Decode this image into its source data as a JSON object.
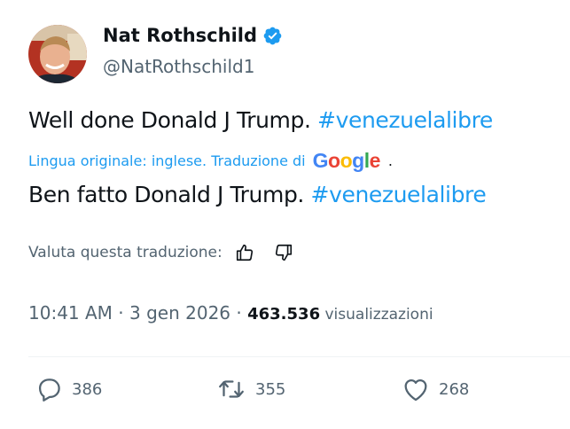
{
  "author": {
    "name": "Nat Rothschild",
    "handle": "@NatRothschild1",
    "verified_color": "#1d9bf0"
  },
  "tweet": {
    "text_plain": "Well done Donald J Trump. ",
    "hashtag": "#venezuelalibre",
    "translation_note": "Lingua originale: inglese. Traduzione di",
    "translator_logo": "Google",
    "translator_dot": ".",
    "translated_plain": "Ben fatto Donald J Trump. ",
    "translated_hashtag": "#venezuelalibre"
  },
  "rating": {
    "label": "Valuta questa traduzione:",
    "up_icon": "thumbs-up-icon",
    "down_icon": "thumbs-down-icon"
  },
  "meta": {
    "time": "10:41 AM",
    "separator": " · ",
    "date": "3 gen 2026",
    "separator2": " · ",
    "views_count": "463.536",
    "views_label": " visualizzazioni"
  },
  "actions": {
    "replies": "386",
    "retweets": "355",
    "likes": "268"
  },
  "colors": {
    "accent": "#1d9bf0",
    "text": "#0f1419",
    "secondary": "#536471"
  }
}
